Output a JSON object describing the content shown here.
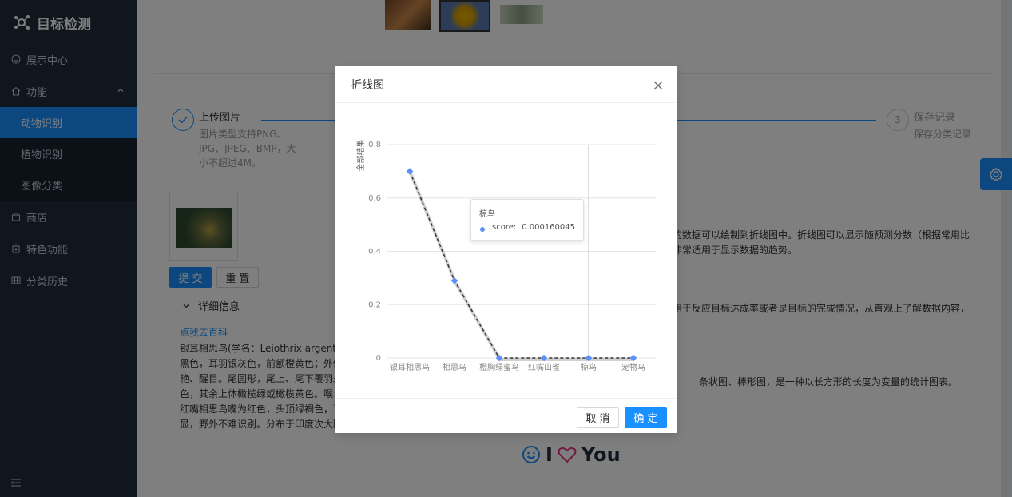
{
  "app": {
    "title": "目标检测"
  },
  "sidebar": {
    "items": [
      {
        "label": "展示中心",
        "icon": "dashboard-icon"
      },
      {
        "label": "功能",
        "icon": "home-icon",
        "expanded": true,
        "children": [
          {
            "label": "动物识别",
            "active": true
          },
          {
            "label": "植物识别"
          },
          {
            "label": "图像分类"
          }
        ]
      },
      {
        "label": "商店",
        "icon": "shop-icon"
      },
      {
        "label": "特色功能",
        "icon": "feature-icon"
      },
      {
        "label": "分类历史",
        "icon": "table-icon"
      }
    ]
  },
  "steps": [
    {
      "title": "上传图片",
      "desc": [
        "图片类型支持PNG、",
        "JPG、JPEG、BMP，大",
        "小不超过4M。"
      ]
    },
    {
      "number": "3",
      "title": "保存记录",
      "desc": [
        "保存分类记录"
      ]
    }
  ],
  "form": {
    "submit_label": "提 交",
    "reset_label": "重 置",
    "details_label": "详细信息",
    "baike_link": "点我去百科"
  },
  "description_lines": [
    "银耳相思鸟(学名：Leiothrix argentauri",
    "黑色，耳羽银灰色，前额橙黄色；外侧",
    "艳、醒目。尾圆形，尾上、尾下覆羽末",
    "色，其余上体橄榄绿或橄榄黄色。喉、",
    "红嘴相思鸟嘴为红色，头顶绿褐色，耳",
    "显，野外不难识别。分布于印度次大陆"
  ],
  "right_texts": {
    "line_chart_desc_1": "的数据可以绘制到折线图中。折线图可以显示随预测分数（根据常用比",
    "line_chart_desc_2": "非常适用于显示数据的趋势。",
    "pie_desc": "用于反应目标达成率或者是目标的完成情况，从直观上了解数据内容，",
    "bar_desc": "条状图、棒形图，是一种以长方形的长度为变量的统计图表。"
  },
  "footer_brand": {
    "i": "I",
    "you": "You"
  },
  "modal": {
    "title": "折线图",
    "cancel_label": "取 消",
    "ok_label": "确 定"
  },
  "chart_data": {
    "type": "line",
    "categories": [
      "银耳相思鸟",
      "相思鸟",
      "橙胸绿蜜鸟",
      "红嘴山雀",
      "椋鸟",
      "宠物鸟"
    ],
    "series": [
      {
        "name": "score",
        "values": [
          0.7,
          0.29,
          0.0,
          0.0,
          0.000160045,
          0.0
        ],
        "color": "#5b8ff9"
      }
    ],
    "ylabel": "全部结果",
    "ylim": [
      0,
      0.8
    ],
    "yticks": [
      "0",
      "0.2",
      "0.4",
      "0.6",
      "0.8"
    ],
    "grid": true,
    "tooltip": {
      "category": "椋鸟",
      "series": "score:",
      "value": "0.000160045"
    }
  },
  "colors": {
    "accent": "#1890ff",
    "sidebar": "#1f2d3d",
    "line": "#5b8ff9"
  }
}
